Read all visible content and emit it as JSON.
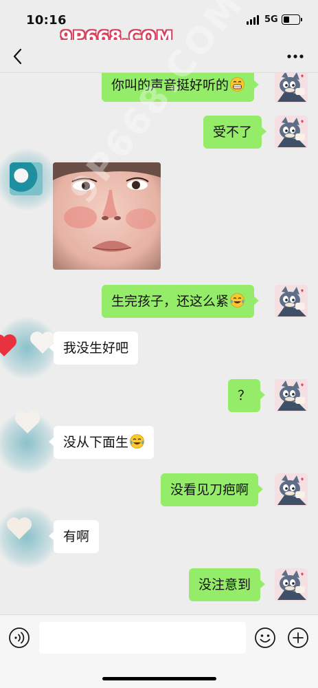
{
  "status_bar": {
    "time": "10:16",
    "network": "5G",
    "battery_level": 0.4
  },
  "watermark": {
    "text": "9P668.COM"
  },
  "header": {
    "title": "",
    "back_icon": "chevron-left-icon",
    "more_icon": "more-dots-icon"
  },
  "messages": [
    {
      "side": "out",
      "type": "text",
      "text": "你叫的声音挺好听的",
      "emoji": "grin-emoji"
    },
    {
      "side": "out",
      "type": "text",
      "text": "受不了"
    },
    {
      "side": "in",
      "type": "image",
      "content": "selfie-photo"
    },
    {
      "side": "out",
      "type": "text",
      "text": "生完孩子，还这么紧",
      "emoji": "laugh-cry-emoji"
    },
    {
      "side": "in",
      "type": "text",
      "text": "我没生好吧"
    },
    {
      "side": "out",
      "type": "text",
      "text": "？"
    },
    {
      "side": "in",
      "type": "text",
      "text": "没从下面生",
      "emoji": "laugh-cry-emoji"
    },
    {
      "side": "out",
      "type": "text",
      "text": "没看见刀疤啊"
    },
    {
      "side": "in",
      "type": "text",
      "text": "有啊"
    },
    {
      "side": "out",
      "type": "text",
      "text": "没注意到"
    }
  ],
  "input_bar": {
    "voice_icon": "voice-icon",
    "input_value": "",
    "emoji_icon": "smiley-icon",
    "plus_icon": "plus-icon"
  },
  "colors": {
    "outgoing_bubble": "#95ec69",
    "incoming_bubble": "#ffffff",
    "background": "#ededed",
    "watermark_outline": "#d9425c"
  }
}
